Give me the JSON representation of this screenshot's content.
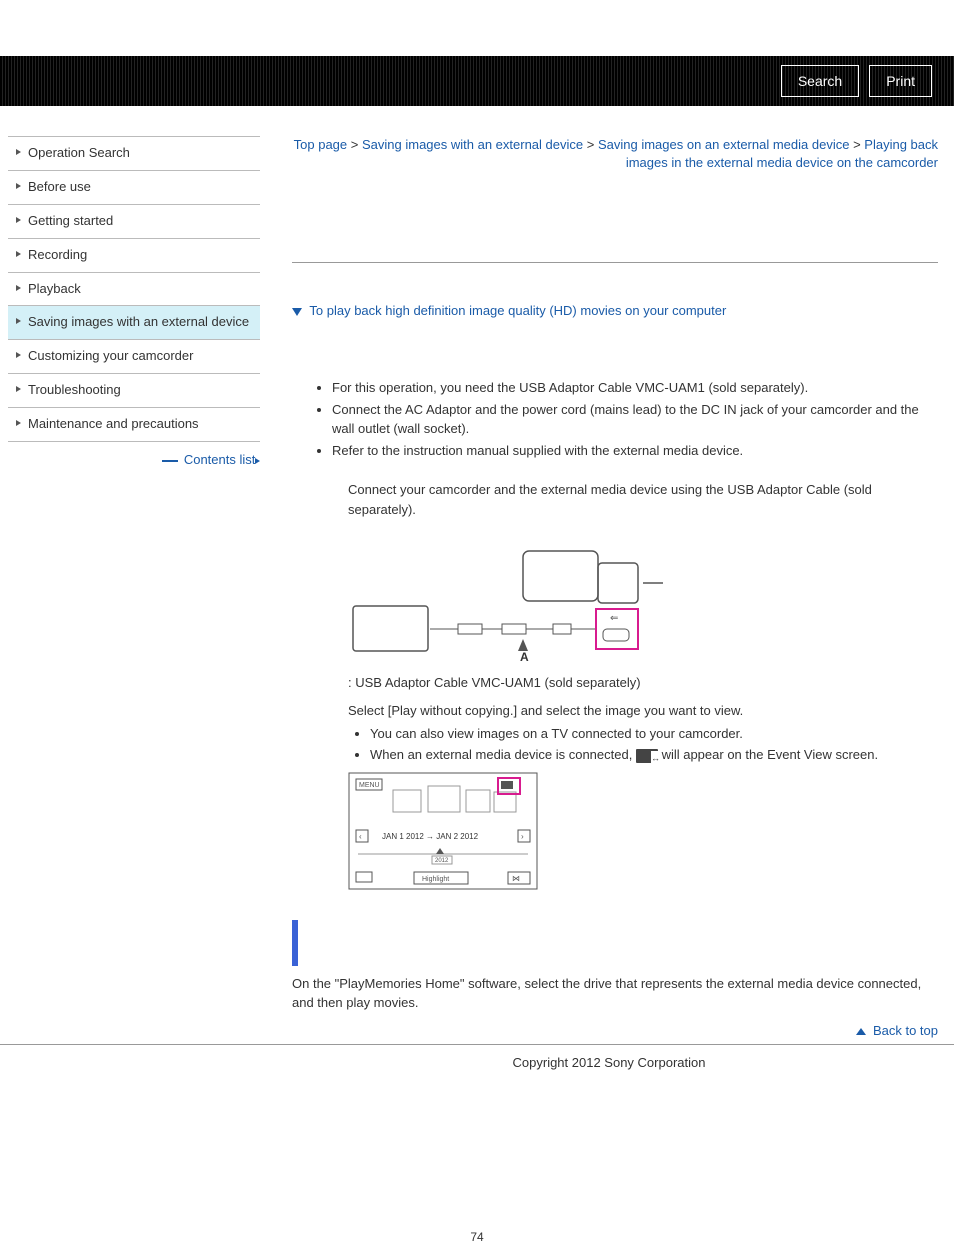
{
  "topbar": {
    "search": "Search",
    "print": "Print"
  },
  "breadcrumb": {
    "p1": "Top page",
    "p2": "Saving images with an external device",
    "p3": "Saving images on an external media device",
    "p4": "Playing back images in the external media device on the camcorder"
  },
  "sidebar": {
    "items": [
      "Operation Search",
      "Before use",
      "Getting started",
      "Recording",
      "Playback",
      "Saving images with an external device",
      "Customizing your camcorder",
      "Troubleshooting",
      "Maintenance and precautions"
    ],
    "contents": "Contents list"
  },
  "collapsible": {
    "title": "To play back high definition image quality (HD) movies on your computer"
  },
  "prep": [
    "For this operation, you need the USB Adaptor Cable VMC-UAM1 (sold separately).",
    "Connect the AC Adaptor and the power cord (mains lead) to the DC IN jack of your camcorder and the wall outlet (wall socket).",
    "Refer to the instruction manual supplied with the external media device."
  ],
  "step1": "Connect your camcorder and the external media device using the USB Adaptor Cable (sold separately).",
  "label_a": " : USB Adaptor Cable VMC-UAM1 (sold separately)",
  "step2": "Select [Play without copying.] and select the image you want to view.",
  "sub": [
    "You can also view images on a TV connected to your camcorder.",
    "When an external media device is connected, "
  ],
  "sub_tail": " will appear on the Event View screen.",
  "lcd": {
    "menu": "MENU",
    "date": "JAN 1 2012 → JAN 2 2012",
    "year": "2012",
    "highlight": "Highlight"
  },
  "playmem": "On the \"PlayMemories Home\" software, select the drive that represents the external media device connected, and then play movies.",
  "backtop": "Back to top",
  "copyright": "Copyright 2012 Sony Corporation",
  "pagenum": "74"
}
